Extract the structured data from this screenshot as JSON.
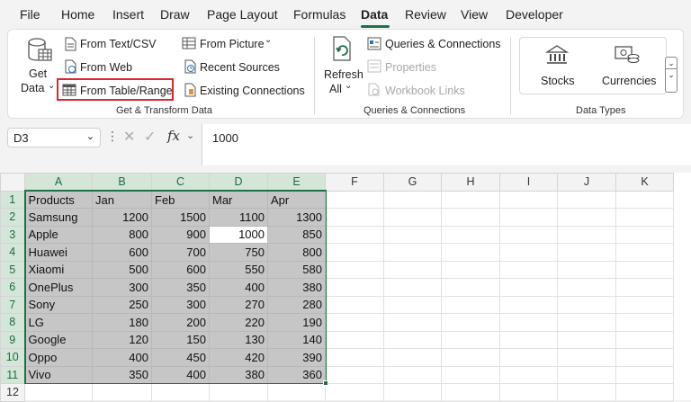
{
  "tabs": [
    "File",
    "Home",
    "Insert",
    "Draw",
    "Page Layout",
    "Formulas",
    "Data",
    "Review",
    "View",
    "Developer"
  ],
  "active_tab": "Data",
  "ribbon": {
    "get_data": {
      "line1": "Get",
      "line2": "Data"
    },
    "from_text_csv": "From Text/CSV",
    "from_web": "From Web",
    "from_table_range": "From Table/Range",
    "from_picture": "From Picture",
    "recent_sources": "Recent Sources",
    "existing_connections": "Existing Connections",
    "group_get_transform": "Get & Transform Data",
    "refresh": {
      "line1": "Refresh",
      "line2": "All"
    },
    "queries_connections": "Queries & Connections",
    "properties": "Properties",
    "workbook_links": "Workbook Links",
    "group_queries": "Queries & Connections",
    "stocks": "Stocks",
    "currencies": "Currencies",
    "group_data_types": "Data Types"
  },
  "formula_bar": {
    "name_box": "D3",
    "fx": "fx",
    "value": "1000"
  },
  "sheet": {
    "columns": [
      "A",
      "B",
      "C",
      "D",
      "E",
      "F",
      "G",
      "H",
      "I",
      "J",
      "K"
    ],
    "rows": [
      [
        "Products",
        "Jan",
        "Feb",
        "Mar",
        "Apr"
      ],
      [
        "Samsung",
        "1200",
        "1500",
        "1100",
        "1300"
      ],
      [
        "Apple",
        "800",
        "900",
        "1000",
        "850"
      ],
      [
        "Huawei",
        "600",
        "700",
        "750",
        "800"
      ],
      [
        "Xiaomi",
        "500",
        "600",
        "550",
        "580"
      ],
      [
        "OnePlus",
        "300",
        "350",
        "400",
        "380"
      ],
      [
        "Sony",
        "250",
        "300",
        "270",
        "280"
      ],
      [
        "LG",
        "180",
        "200",
        "220",
        "190"
      ],
      [
        "Google",
        "120",
        "150",
        "130",
        "140"
      ],
      [
        "Oppo",
        "400",
        "450",
        "420",
        "390"
      ],
      [
        "Vivo",
        "350",
        "400",
        "380",
        "360"
      ]
    ],
    "row_numbers": [
      "1",
      "2",
      "3",
      "4",
      "5",
      "6",
      "7",
      "8",
      "9",
      "10",
      "11",
      "12"
    ],
    "active_cell": "D3"
  },
  "colors": {
    "accent": "#1e7145",
    "highlight": "#e0262d",
    "selection_fill": "#c6c6c6"
  }
}
